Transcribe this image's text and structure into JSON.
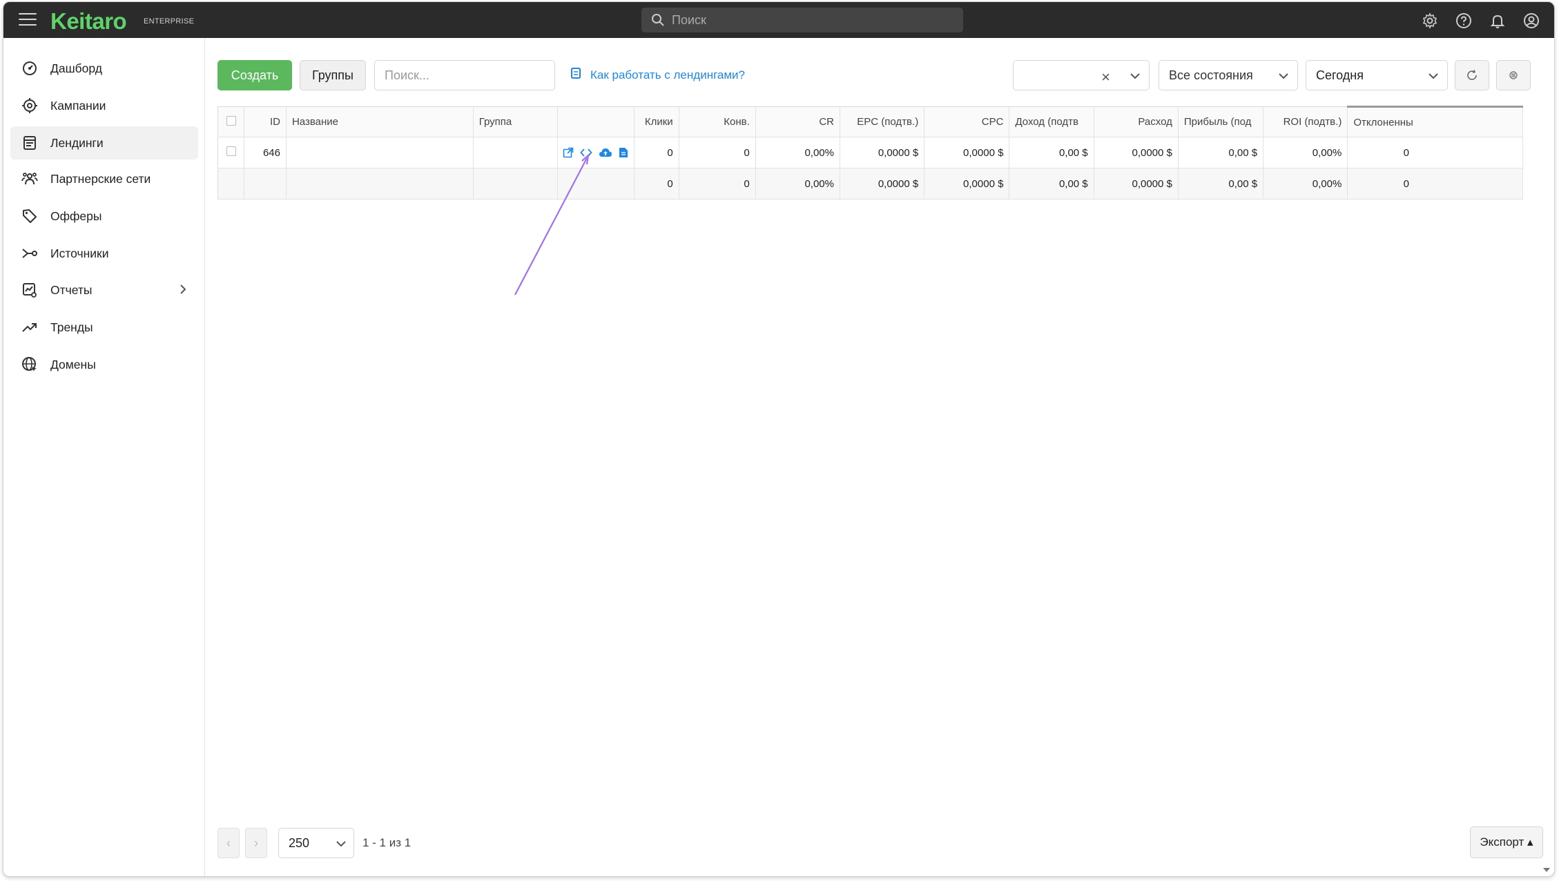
{
  "app": {
    "logo": "Keitaro",
    "logo_sub": "ENTERPRISE",
    "search_placeholder": "Поиск",
    "brand_color": "#5fd36a",
    "topbar_icons": [
      "gear-icon",
      "help-icon",
      "bell-icon",
      "user-icon"
    ]
  },
  "sidebar": {
    "items": [
      {
        "label": "Дашборд",
        "icon": "dashboard-icon"
      },
      {
        "label": "Кампании",
        "icon": "target-icon"
      },
      {
        "label": "Лендинги",
        "icon": "landing-icon",
        "active": true
      },
      {
        "label": "Партнерские сети",
        "icon": "people-icon"
      },
      {
        "label": "Офферы",
        "icon": "tag-icon"
      },
      {
        "label": "Источники",
        "icon": "source-icon"
      },
      {
        "label": "Отчеты",
        "icon": "report-icon",
        "has_submenu": true
      },
      {
        "label": "Тренды",
        "icon": "trend-icon"
      },
      {
        "label": "Домены",
        "icon": "globe-icon"
      }
    ]
  },
  "toolbar": {
    "create_label": "Создать",
    "groups_label": "Группы",
    "search_placeholder": "Поиск...",
    "help_link": "Как работать с лендингами?",
    "filter_empty_value": "",
    "states_value": "Все состояния",
    "period_value": "Сегодня",
    "create_color": "#5cb85c",
    "link_color": "#1e88e5"
  },
  "table": {
    "columns": [
      "",
      "ID",
      "Название",
      "Группа",
      "",
      "Клики",
      "Конв.",
      "CR",
      "EPC (подтв.)",
      "CPC",
      "Доход (подтв",
      "Расход",
      "Прибыль (под",
      "ROI (подтв.)",
      "Отклоненны"
    ],
    "rows": [
      {
        "id": "646",
        "name": "",
        "group": "",
        "clicks": "0",
        "conv": "0",
        "cr": "0,00%",
        "epc": "0,0000 $",
        "cpc": "0,0000 $",
        "revenue": "0,00 $",
        "cost": "0,0000 $",
        "profit": "0,00 $",
        "roi": "0,00%",
        "rejected": "0"
      }
    ],
    "totals": {
      "clicks": "0",
      "conv": "0",
      "cr": "0,00%",
      "epc": "0,0000 $",
      "cpc": "0,0000 $",
      "revenue": "0,00 $",
      "cost": "0,0000 $",
      "profit": "0,00 $",
      "roi": "0,00%",
      "rejected": "0"
    },
    "row_action_icons": [
      "external-link-icon",
      "code-icon",
      "cloud-upload-icon",
      "document-icon"
    ]
  },
  "footer": {
    "page_size": "250",
    "page_info": "1 - 1 из 1",
    "export_label": "Экспорт"
  },
  "annotation": {
    "arrow_color": "#a070f0"
  }
}
